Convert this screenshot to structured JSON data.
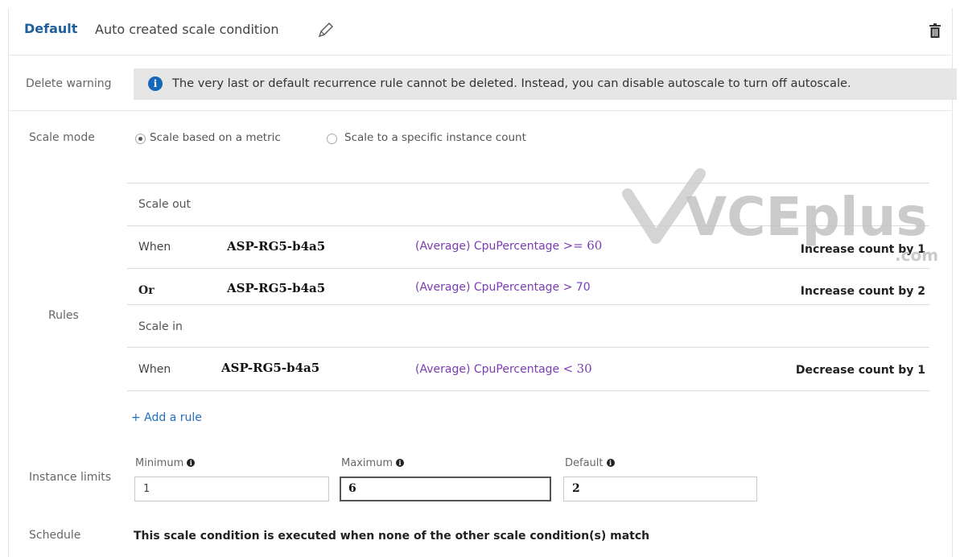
{
  "header": {
    "default_label": "Default",
    "condition_name": "Auto created scale condition"
  },
  "warning": {
    "label": "Delete warning",
    "text": "The very last or default recurrence rule cannot be deleted. Instead, you can disable autoscale to turn off autoscale."
  },
  "scale_mode": {
    "label": "Scale mode",
    "options": [
      "Scale based on a metric",
      "Scale to a specific instance count"
    ],
    "selected": "Scale based on a metric"
  },
  "rules": {
    "label": "Rules",
    "scale_out_label": "Scale out",
    "scale_in_label": "Scale in",
    "scale_out": [
      {
        "condition": "When",
        "resource": "ASP-RG5-b4a5",
        "metric": "(Average) CpuPercentage",
        "operator": ">=",
        "threshold": "60",
        "action": "Increase count by 1"
      },
      {
        "condition": "Or",
        "resource": "ASP-RG5-b4a5",
        "metric": "(Average) CpuPercentage",
        "operator": ">",
        "threshold": "70",
        "action": "Increase count by 2"
      }
    ],
    "scale_in": [
      {
        "condition": "When",
        "resource": "ASP-RG5-b4a5",
        "metric": "(Average) CpuPercentage",
        "operator": "<",
        "threshold": "30",
        "action": "Decrease count by 1"
      }
    ],
    "add_rule": "+ Add a rule"
  },
  "instance_limits": {
    "label": "Instance limits",
    "minimum_label": "Minimum",
    "minimum_value": "1",
    "maximum_label": "Maximum",
    "maximum_value": "6",
    "default_label": "Default",
    "default_value": "2"
  },
  "schedule": {
    "label": "Schedule",
    "text": "This scale condition is executed when none of the other scale condition(s) match"
  },
  "watermark": {
    "text": "VCEplus",
    "subtext": ".com"
  },
  "colors": {
    "accent_blue": "#1f5f9e",
    "metric_purple": "#7a3bb3",
    "info_blue": "#1468b7",
    "warning_bg": "#e6e6e6"
  }
}
